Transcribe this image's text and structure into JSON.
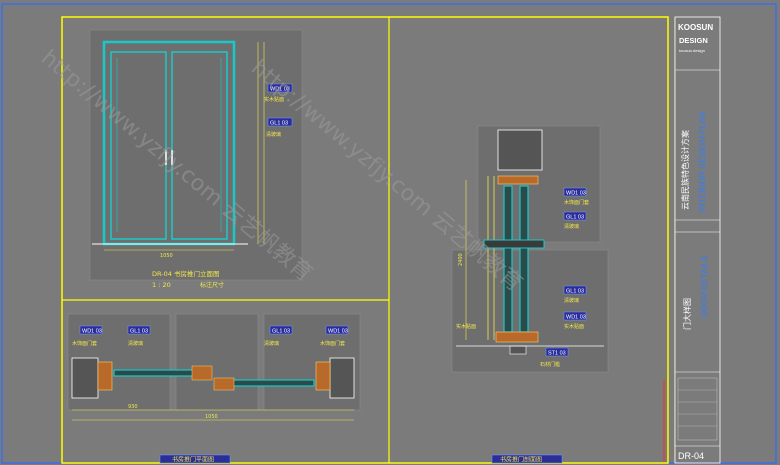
{
  "brand": {
    "name": "KOOSUN",
    "line2": "DESIGN",
    "line3": "koosun.design"
  },
  "title_block": {
    "project_cn": "云南民族特色设计方案",
    "project_en": "INTERIOR DESIGN PLAN",
    "drawing_cn": "门大样图",
    "drawing_en": "DOOR DETAILS",
    "sheet_no": "DR-04"
  },
  "views": {
    "elevation_title": "DR-04 书房推门立面图",
    "elevation_scale": "1 : 20",
    "elevation_note": "标注尺寸",
    "plan_title": "书房推门平面图",
    "section_title": "书房推门剖面图"
  },
  "tags": {
    "code_a": "WD1 03",
    "code_b": "GL1 03",
    "code_c": "ST1 03"
  },
  "labels": {
    "wood": "实木贴面",
    "glass": "清玻璃",
    "frame": "木饰面门套",
    "stone": "石材门槛"
  },
  "dims": {
    "d1": "1050",
    "d2": "60",
    "d3": "930",
    "d4": "60",
    "d5": "2400"
  },
  "watermark": "http://www.yzfjy.com  云艺帆教育",
  "colors": {
    "frame": "#ffff00",
    "line": "#f2e84a",
    "cyan": "#19c9c9",
    "brand": "#2f7dff"
  }
}
